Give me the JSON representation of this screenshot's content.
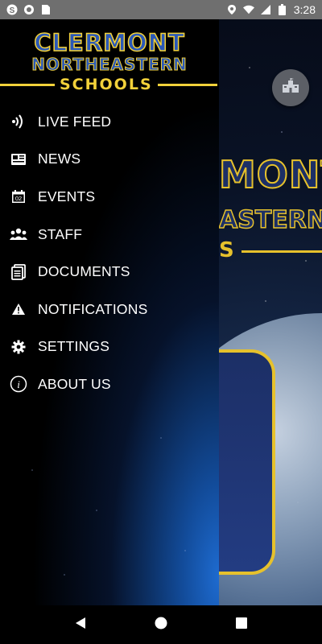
{
  "status_bar": {
    "time": "3:28",
    "left_icons": [
      "skype-icon",
      "sync-icon",
      "sim-card-icon"
    ],
    "right_icons": [
      "location-icon",
      "wifi-icon",
      "signal-icon",
      "battery-icon"
    ]
  },
  "drawer": {
    "logo": {
      "line1": "CLERMONT",
      "line2": "NORTHEASTERN",
      "line3": "SCHOOLS"
    },
    "items": [
      {
        "label": "LIVE FEED",
        "icon": "live-feed-icon"
      },
      {
        "label": "NEWS",
        "icon": "news-icon"
      },
      {
        "label": "EVENTS",
        "icon": "calendar-icon"
      },
      {
        "label": "STAFF",
        "icon": "staff-icon"
      },
      {
        "label": "DOCUMENTS",
        "icon": "documents-icon"
      },
      {
        "label": "NOTIFICATIONS",
        "icon": "warning-icon"
      },
      {
        "label": "SETTINGS",
        "icon": "gear-icon"
      },
      {
        "label": "ABOUT US",
        "icon": "info-icon"
      }
    ],
    "events_icon_day": "02"
  },
  "background": {
    "logo_line1": "MONT",
    "logo_line2": "ASTERN",
    "logo_line3": "S",
    "fab_icon": "school-icon"
  },
  "colors": {
    "accent_gold": "#f2d13a",
    "logo_blue": "#2a58b8",
    "status_bar": "#6f6f6f"
  },
  "nav_bar": {
    "buttons": [
      "back-icon",
      "home-icon",
      "recents-icon"
    ]
  }
}
